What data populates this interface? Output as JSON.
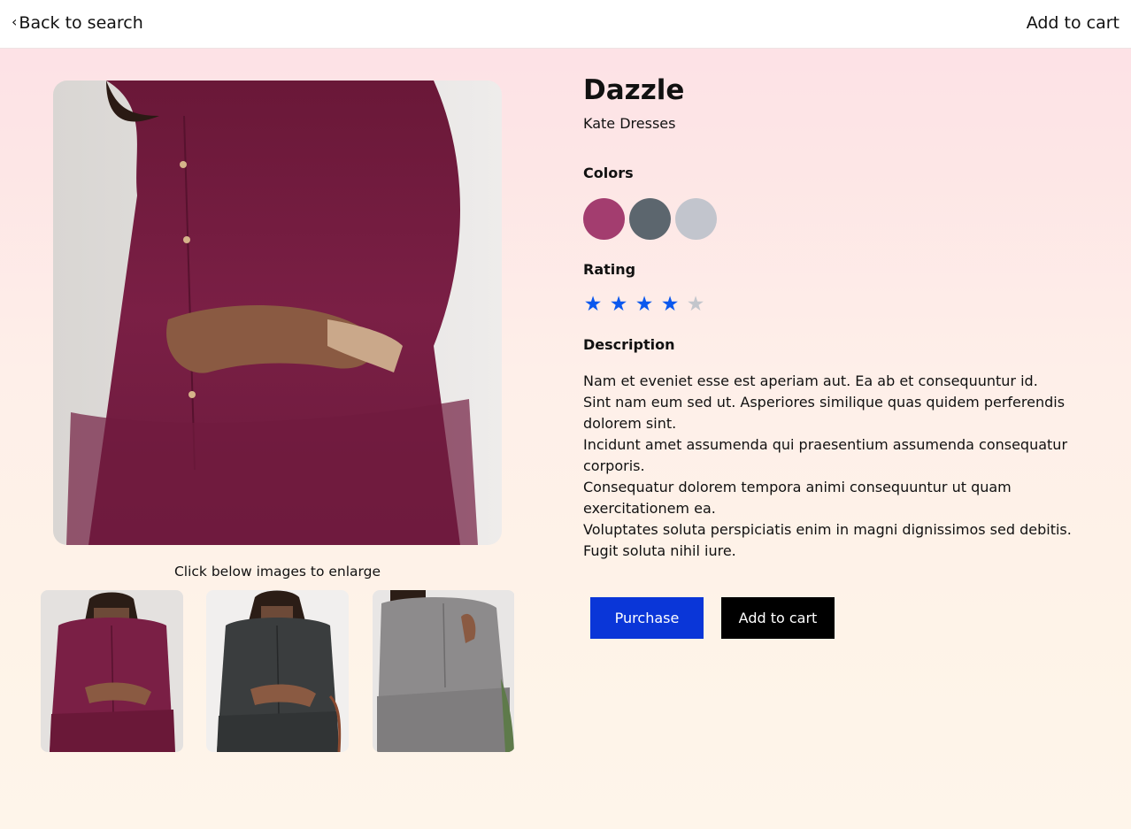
{
  "topbar": {
    "back_label": "Back to search",
    "cart_label": "Add to cart"
  },
  "gallery": {
    "hint": "Click below images to enlarge",
    "thumbnails": [
      {
        "color_name": "burgundy",
        "color": "#7a1f45"
      },
      {
        "color_name": "dark-gray",
        "color": "#3a3d3e"
      },
      {
        "color_name": "light-gray",
        "color": "#8d8b8c"
      }
    ]
  },
  "product": {
    "title": "Dazzle",
    "brand": "Kate Dresses",
    "colors_heading": "Colors",
    "colors": [
      "#a33d6f",
      "#5c666e",
      "#c2c5cd"
    ],
    "rating_heading": "Rating",
    "rating": 4,
    "rating_max": 5,
    "star_filled_color": "#0b58ee",
    "star_empty_color": "#c3c6cc",
    "description_heading": "Description",
    "description": [
      "Nam et eveniet esse est aperiam aut. Ea ab et consequuntur id.",
      "Sint nam eum sed ut. Asperiores similique quas quidem perferendis dolorem sint.",
      "Incidunt amet assumenda qui praesentium assumenda consequatur corporis.",
      "Consequatur dolorem tempora animi consequuntur ut quam exercitationem ea.",
      "Voluptates soluta perspiciatis enim in magni dignissimos sed debitis. Fugit soluta nihil iure."
    ]
  },
  "actions": {
    "purchase_label": "Purchase",
    "purchase_color": "#0a36d8",
    "cart_label": "Add to cart"
  }
}
